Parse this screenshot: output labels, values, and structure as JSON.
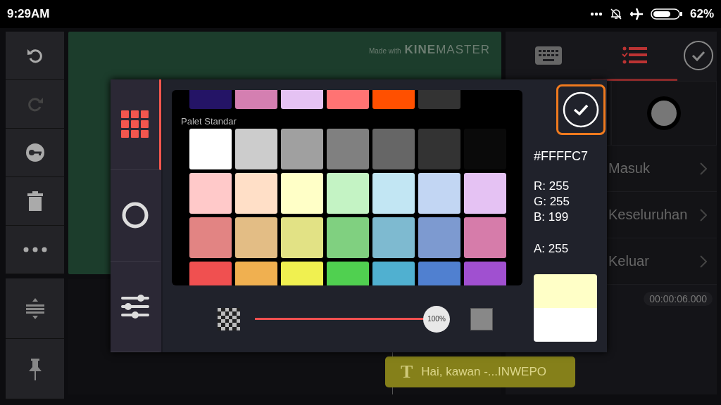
{
  "status_bar": {
    "time": "9:29AM",
    "battery": "62%"
  },
  "preview": {
    "watermark": "Made with",
    "brand": [
      "KINE",
      "MASTER"
    ]
  },
  "right_panel": {
    "tabs": [
      {
        "kind": "keyboard",
        "selected": false
      },
      {
        "kind": "list",
        "selected": true
      }
    ],
    "items": [
      {
        "label": "Masuk"
      },
      {
        "label": "Keseluruhan"
      },
      {
        "label": "Keluar"
      }
    ],
    "time": "00:00:06.000"
  },
  "timeline": {
    "clip_icon": "T",
    "clip": "Hai, kawan -...INWEPO"
  },
  "dialog": {
    "modes": [
      {
        "kind": "grid",
        "selected": true
      },
      {
        "kind": "ring",
        "selected": false
      },
      {
        "kind": "sliders",
        "selected": false
      }
    ],
    "recent_colors": [
      {
        "color": "#241466"
      },
      {
        "color": "#d47fb1"
      },
      {
        "color": "#e5c2f3"
      },
      {
        "color": "#ff7373"
      },
      {
        "color": "#ff5000"
      },
      {
        "color": "#333333"
      }
    ],
    "palette_title": "Palet Standar",
    "palette": [
      {
        "color": "#ffffff"
      },
      {
        "color": "#cccccc"
      },
      {
        "color": "#a0a0a0"
      },
      {
        "color": "#808080"
      },
      {
        "color": "#666666"
      },
      {
        "color": "#333333"
      },
      {
        "color": "#0a0a0a"
      },
      {
        "color": "#ffc9c9"
      },
      {
        "color": "#ffdfc7"
      },
      {
        "color": "#ffffc7"
      },
      {
        "color": "#c4f3c4"
      },
      {
        "color": "#c2e6f3"
      },
      {
        "color": "#c2d6f3"
      },
      {
        "color": "#e5c2f3"
      },
      {
        "color": "#e28483"
      },
      {
        "color": "#e3bd85"
      },
      {
        "color": "#e2e285"
      },
      {
        "color": "#80d080"
      },
      {
        "color": "#7ebad0"
      },
      {
        "color": "#7d9ad0"
      },
      {
        "color": "#d67caa"
      },
      {
        "color": "#f05050"
      },
      {
        "color": "#f0b050"
      },
      {
        "color": "#f0f050"
      },
      {
        "color": "#50d050"
      },
      {
        "color": "#50b0d0"
      },
      {
        "color": "#5080d0"
      },
      {
        "color": "#a050d0"
      }
    ],
    "hex": "#FFFFC7",
    "channels": [
      "R: 255",
      "G: 255",
      "B: 199"
    ],
    "alpha": "A: 255",
    "opacity": {
      "level": 1,
      "reading": "100%"
    }
  }
}
